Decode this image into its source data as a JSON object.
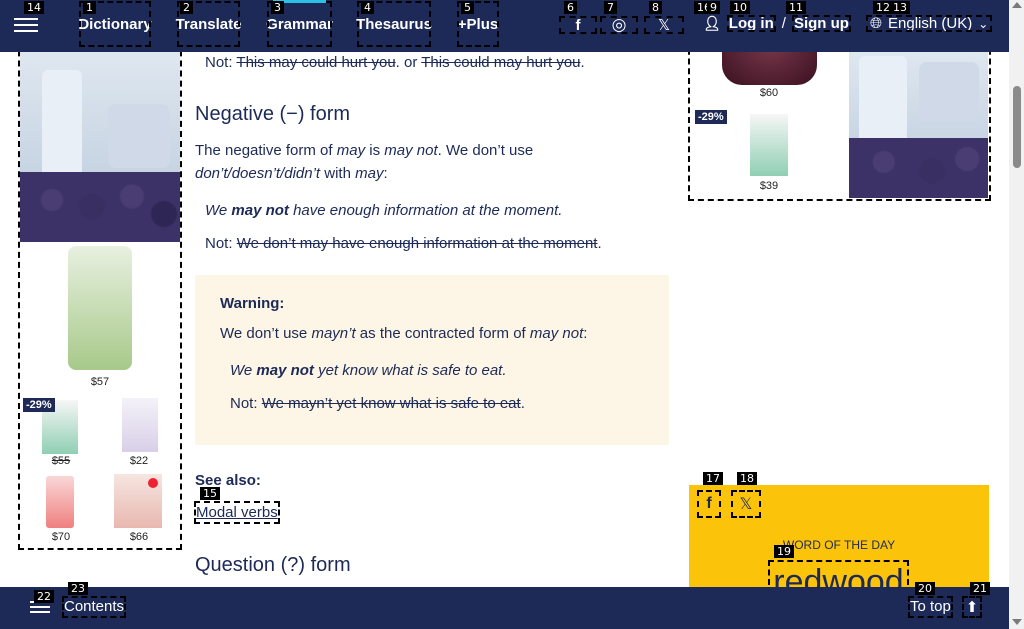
{
  "nav": {
    "items": [
      {
        "label": "Dictionary",
        "tag": "1"
      },
      {
        "label": "Translate",
        "tag": "2"
      },
      {
        "label": "Grammar",
        "tag": "3"
      },
      {
        "label": "Thesaurus",
        "tag": "4"
      },
      {
        "label": "+Plus",
        "tag": "5"
      }
    ],
    "social": [
      {
        "icon": "facebook-icon",
        "glyph": "f",
        "tag": "6"
      },
      {
        "icon": "instagram-icon",
        "glyph": "◎",
        "tag": "7"
      },
      {
        "icon": "x-twitter-icon",
        "glyph": "𝕏",
        "tag": "8"
      }
    ],
    "login": "Log in",
    "slash": "/",
    "signup": "Sign up",
    "language": "English (UK)",
    "menu_tag": "14",
    "tags_extra": [
      "16",
      "9",
      "10",
      "11",
      "12",
      "13"
    ]
  },
  "left_ad": {
    "products": [
      {
        "price": "$57"
      },
      {
        "discount": "-29%",
        "price": "$55",
        "strike": true
      },
      {
        "price": "$22"
      },
      {
        "price": "$70"
      },
      {
        "price": "$66"
      }
    ]
  },
  "right_ad": {
    "products": [
      {
        "price": "$60"
      },
      {
        "discount": "-29%",
        "price": "$39"
      }
    ]
  },
  "content": {
    "not1": {
      "prefix": "Not:",
      "a": "This may could hurt you",
      "or": ". or",
      "b": "This could may hurt you",
      "end": "."
    },
    "neg_heading": "Negative (−) form",
    "neg_p1_a": "The negative form of ",
    "neg_p1_may": "may",
    "neg_p1_is": " is ",
    "neg_p1_maynot": "may not",
    "neg_p1_b": ". We don’t use",
    "neg_p2_forms": "don’t/doesn’t/didn’t",
    "neg_p2_with": " with ",
    "neg_p2_may": "may",
    "neg_p2_colon": ":",
    "ex1_we": "We ",
    "ex1_maynot": "may not",
    "ex1_rest": " have enough information at the moment.",
    "not2_prefix": "Not:",
    "not2_text": "We don’t may have enough information at the moment",
    "not2_end": ".",
    "warning_title": "Warning:",
    "warning_a": "We don’t use ",
    "warning_mayn": "mayn’t",
    "warning_b": " as the contracted form of ",
    "warning_maynot": "may not",
    "warning_c": ":",
    "ex2_we": "We ",
    "ex2_maynot": "may not",
    "ex2_rest": " yet know what is safe to eat.",
    "not3_prefix": "Not:",
    "not3_text": "We mayn’t yet know what is safe to eat",
    "not3_end": ".",
    "see_also": "See also:",
    "modal_link": "Modal verbs",
    "modal_tag": "15",
    "question_heading": "Question (?) form"
  },
  "wotd": {
    "label": "WORD OF THE DAY",
    "word": "redwood",
    "tags": [
      "17",
      "18",
      "19"
    ]
  },
  "bottom": {
    "contents": "Contents",
    "totop": "To top",
    "tags": [
      "22",
      "23",
      "20",
      "21"
    ]
  },
  "colors": {
    "navy": "#1d2a57",
    "accent": "#2bc0e4",
    "wotd_bg": "#fcc30b",
    "warning_bg": "#fdf6e6"
  }
}
